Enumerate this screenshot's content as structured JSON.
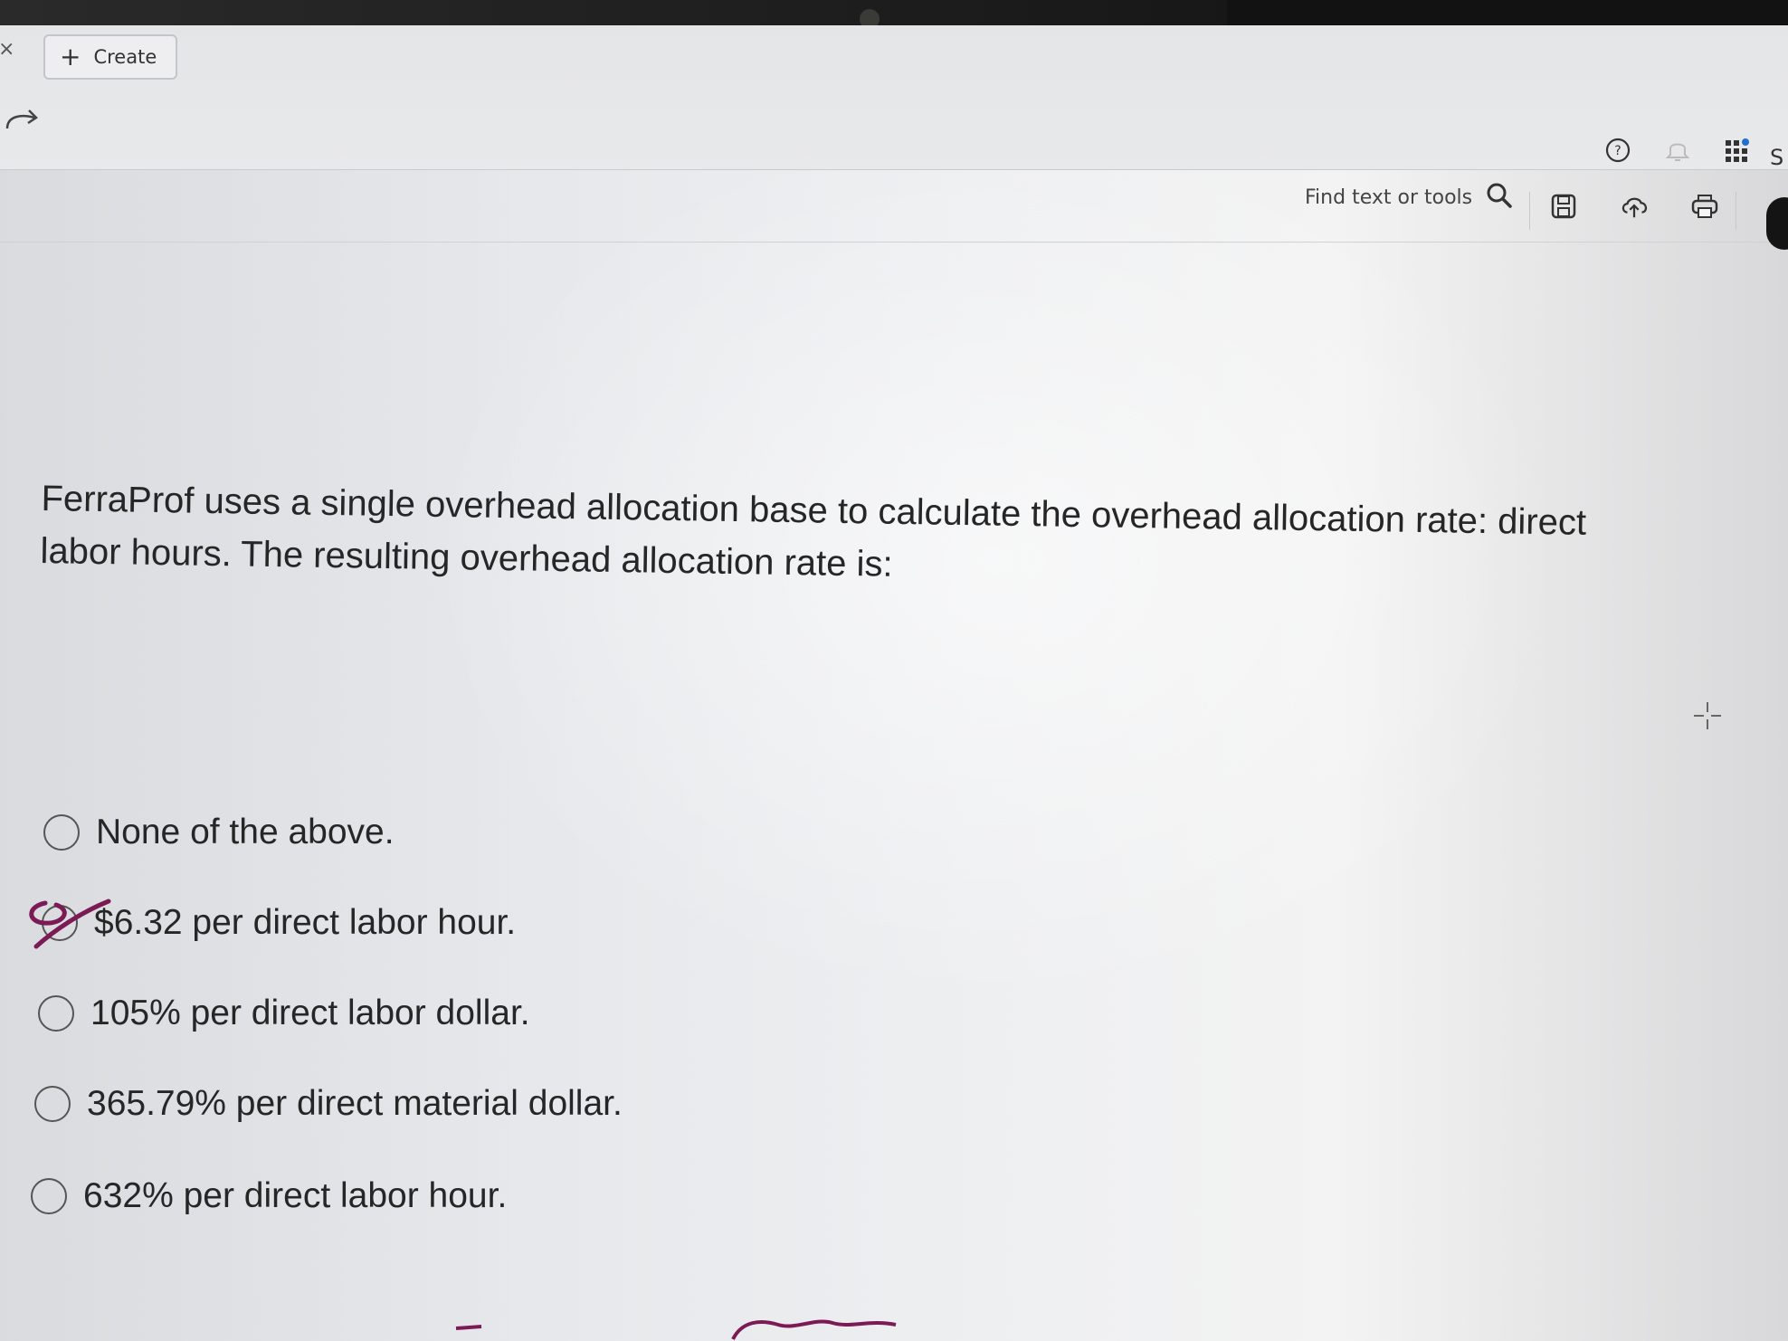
{
  "topbar": {
    "close_glyph": "×",
    "create_button": {
      "icon": "plus-icon",
      "label": "Create"
    },
    "redo_icon": "redo-icon",
    "icons": [
      "help-icon",
      "bell-icon",
      "apps-grid-icon"
    ],
    "sign_in_partial": "S"
  },
  "toolbar": {
    "find_label": "Find text or tools",
    "find_icon": "search-icon",
    "icons": [
      "save-icon",
      "upload-icon",
      "print-icon"
    ]
  },
  "question": {
    "text": "FerraProf uses a single overhead allocation base to calculate the overhead allocation rate: direct labor hours. The resulting overhead allocation rate is:"
  },
  "options": [
    {
      "label": "None of the above.",
      "selected": false
    },
    {
      "label": "$6.32 per direct labor hour.",
      "selected": false,
      "hand_marked": true
    },
    {
      "label": "105% per direct labor dollar.",
      "selected": false
    },
    {
      "label": "365.79% per direct material dollar.",
      "selected": false
    },
    {
      "label": "632% per direct labor hour.",
      "selected": false
    }
  ],
  "colors": {
    "ink_mark": "#7b1a55",
    "text": "#262626",
    "notification_dot": "#1f6fd1"
  }
}
